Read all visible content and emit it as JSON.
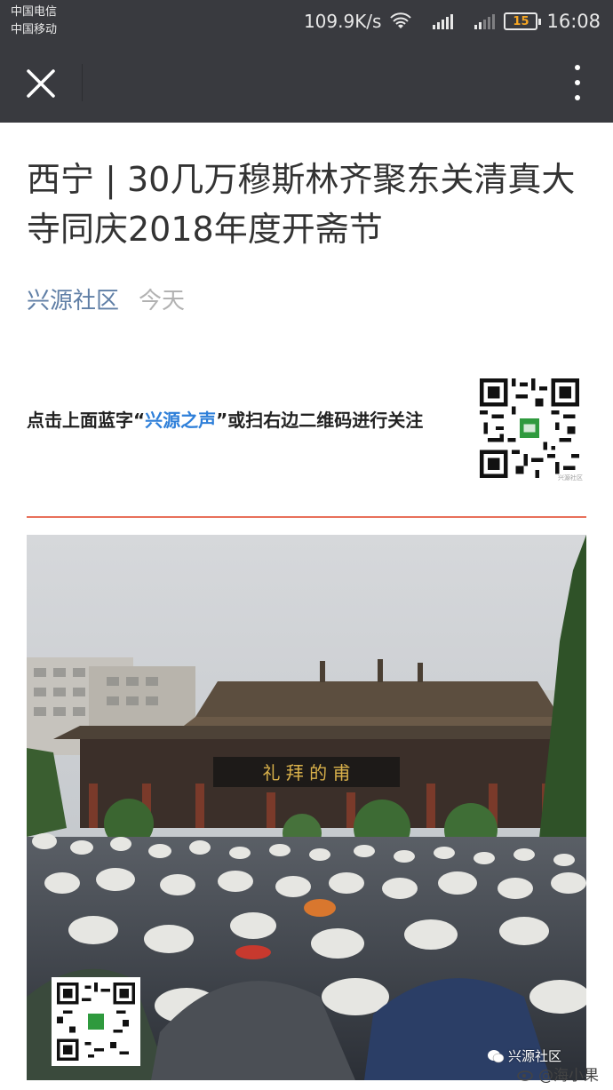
{
  "status_bar": {
    "carrier_1": "中国电信",
    "carrier_2": "中国移动",
    "net_speed": "109.9K/s",
    "signal_1_label": "4G 2G",
    "signal_2_label": "2G",
    "battery": "15",
    "time": "16:08"
  },
  "nav": {
    "close_icon": "close-icon",
    "more_icon": "more-vertical-icon"
  },
  "article": {
    "title": "西宁 | 30几万穆斯林齐聚东关清真大寺同庆2018年度开斋节",
    "account": "兴源社区",
    "date": "今天",
    "follow_prefix": "点击上面蓝字“",
    "follow_highlight": "兴源之声",
    "follow_suffix": "”或扫右边二维码进行关注",
    "qr_caption": "兴源社区"
  },
  "photo": {
    "sign_text": "礼 拜 的 甫",
    "watermark": "兴源社区",
    "qr_label": "兴源社区"
  },
  "footer_watermark": "@海小果",
  "colors": {
    "nav_bg": "#393a3f",
    "link_blue": "#607fa6",
    "highlight_blue": "#2e7fd9",
    "divider_orange": "#e8705a"
  }
}
